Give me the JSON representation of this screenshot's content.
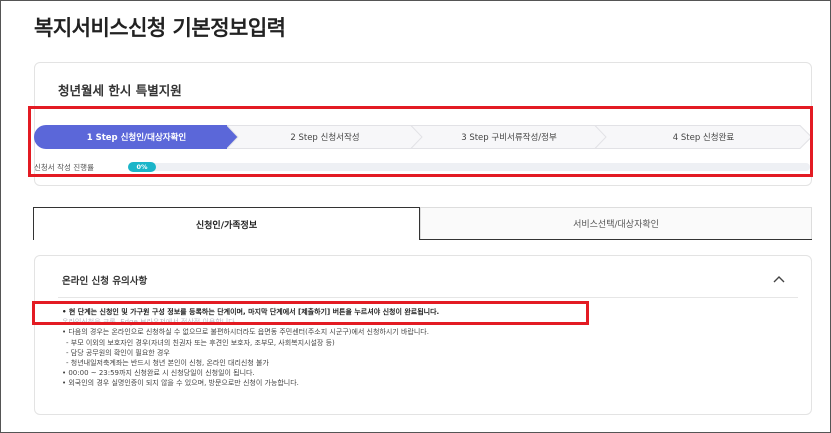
{
  "page": {
    "title": "복지서비스신청 기본정보입력"
  },
  "program": {
    "title": "청년월세 한시 특별지원"
  },
  "steps": [
    {
      "label": "1 Step 신청인/대상자확인",
      "active": true
    },
    {
      "label": "2 Step 신청서작성",
      "active": false
    },
    {
      "label": "3 Step 구비서류작성/정부",
      "active": false
    },
    {
      "label": "4 Step 신청완료",
      "active": false
    }
  ],
  "progress": {
    "label": "신청서 작성 진행률",
    "value_text": "0%",
    "value": 0
  },
  "tabs": [
    {
      "label": "신청인/가족정보",
      "selected": true
    },
    {
      "label": "서비스선택/대상자확인",
      "selected": false
    }
  ],
  "notice": {
    "title": "온라인 신청 유의사항",
    "lines": [
      "• 현 단계는 신청인 및 가구원 구성 정보를 등록하는 단계이며, 마지막 단계에서 [제출하기] 버튼을 누르셔야 신청이 완료됩니다.",
      "온라인신청은 크롬, Edge 브라우저에서 정상적 이용합니다.",
      "• 다음의 경우는 온라인으로 신청하실 수 없으므로 불편하시더라도 읍면동 주민센터(주소지 시군구)에서 신청하시기 바랍니다.",
      "- 부모 이외의 보호자인 경우(자녀의 친권자 또는 후견인 보호자, 조부모, 사회복지시설장 등)",
      "- 담당 공무원의 확인이 필요한 경우",
      "- 청년내일저축계좌는 반드시 청년 본인이 신청, 온라인 대리신청 불가",
      "• 00:00 ~ 23:59까지 신청완료 시 신청당일이 신청일이 됩니다.",
      "• 외국인의 경우 실명인증이 되지 않을 수 있으며, 방문으로만 신청이 가능합니다."
    ]
  },
  "colors": {
    "step_active": "#5b67d9",
    "progress_badge": "#1bb5c9",
    "highlight_box": "#e31b23"
  },
  "icons": {
    "collapse": "chevron-up-icon"
  }
}
